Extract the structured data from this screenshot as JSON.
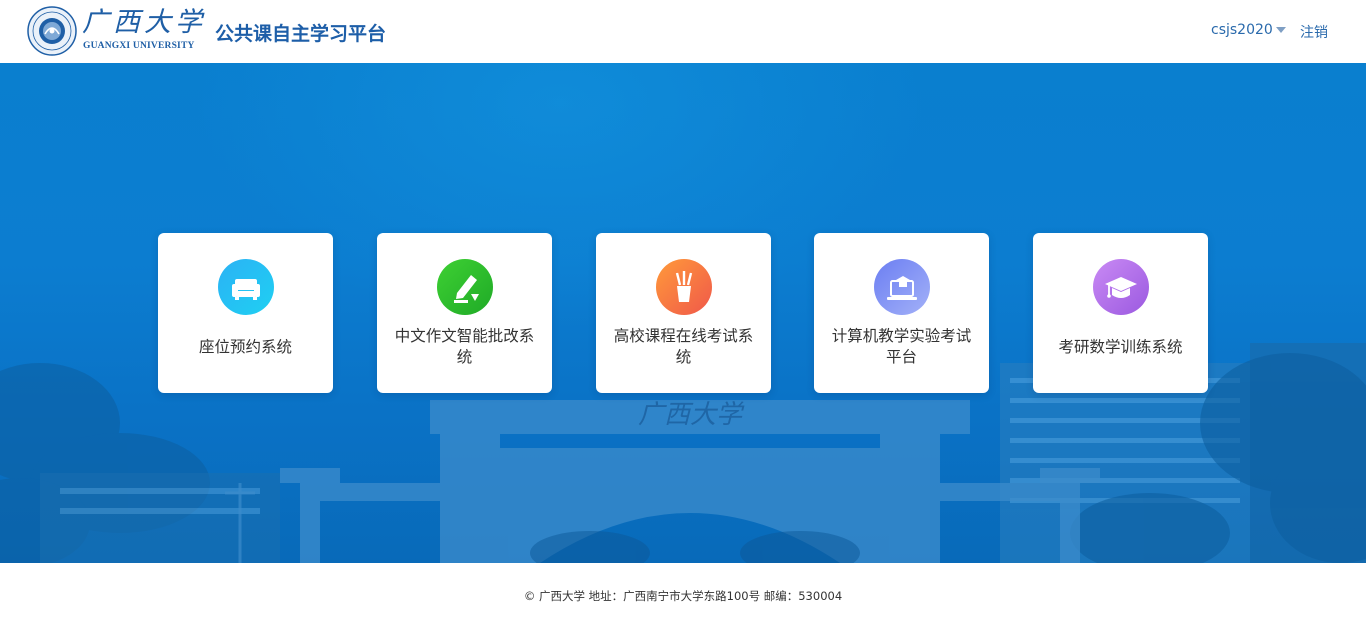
{
  "header": {
    "logo_cn": "广西大学",
    "logo_en": "GUANGXI UNIVERSITY",
    "title": "公共课自主学习平台",
    "username": "csjs2020",
    "logout_label": "注销"
  },
  "banner": {
    "gate_text": "广西大学"
  },
  "cards": [
    {
      "label": "座位预约系统",
      "icon": "armchair-icon",
      "color_from": "#2bb2f5",
      "color_to": "#1fd0f2"
    },
    {
      "label": "中文作文智能批改系统",
      "icon": "pen-paper-icon",
      "color_from": "#34c62a",
      "color_to": "#1fae28"
    },
    {
      "label": "高校课程在线考试系统",
      "icon": "pencil-cup-icon",
      "color_from": "#ff8c3a",
      "color_to": "#f25a4a"
    },
    {
      "label": "计算机教学实验考试平台",
      "icon": "laptop-graduate-icon",
      "color_from": "#6b7ef2",
      "color_to": "#9aa8f7"
    },
    {
      "label": "考研数学训练系统",
      "icon": "graduation-cap-icon",
      "color_from": "#c07af0",
      "color_to": "#9c5ae0"
    }
  ],
  "footer": {
    "text": "© 广西大学 地址：广西南宁市大学东路100号 邮编：530004"
  },
  "colors": {
    "brand": "#1d5ea8",
    "banner": "#0a7fcf"
  }
}
